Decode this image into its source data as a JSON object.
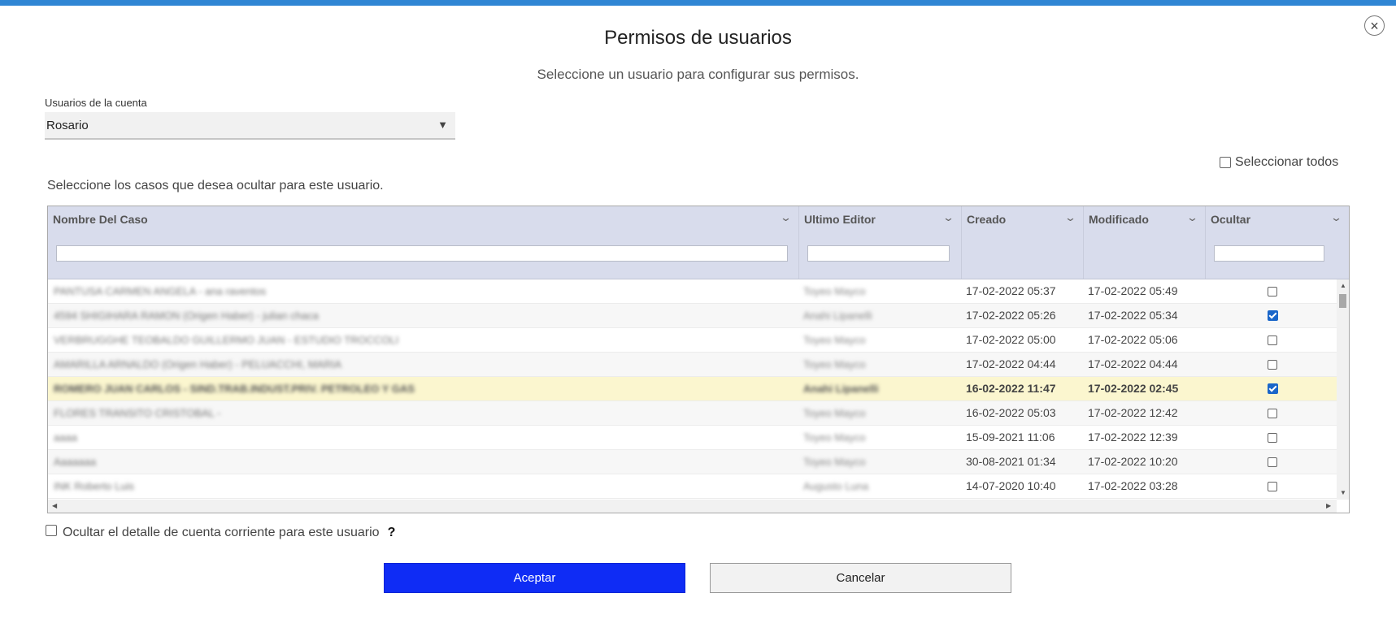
{
  "dialog": {
    "title": "Permisos de usuarios",
    "subtitle": "Seleccione un usuario para configurar sus permisos.",
    "close_symbol": "×"
  },
  "user_select": {
    "label": "Usuarios de la cuenta",
    "value": "Rosario",
    "arrow": "▼"
  },
  "select_all": {
    "label": "Seleccionar todos",
    "checked": false
  },
  "instructions": "Seleccione los casos que desea ocultar para este usuario.",
  "table": {
    "columns": [
      {
        "label": "Nombre Del Caso",
        "icon": "chevron-down-icon"
      },
      {
        "label": "Ultimo Editor",
        "icon": "chevron-down-icon"
      },
      {
        "label": "Creado",
        "icon": "chevron-down-icon"
      },
      {
        "label": "Modificado",
        "icon": "chevron-down-icon"
      },
      {
        "label": "Ocultar",
        "icon": "chevron-down-icon"
      }
    ],
    "rows": [
      {
        "name": "PANTUSA CARMEN ANGELA - ana raventos",
        "editor": "Toyeo Mayco",
        "created": "17-02-2022 05:37",
        "modified": "17-02-2022 05:49",
        "hidden": false,
        "selected": false
      },
      {
        "name": "4594 SHIGIHARA RAMON (Origen Haber) - julian chaca",
        "editor": "Anahi Lipanelli",
        "created": "17-02-2022 05:26",
        "modified": "17-02-2022 05:34",
        "hidden": true,
        "selected": false
      },
      {
        "name": "VERBRUGGHE TEOBALDO GUILLERMO JUAN - ESTUDIO TROCCOLI",
        "editor": "Toyeo Mayco",
        "created": "17-02-2022 05:00",
        "modified": "17-02-2022 05:06",
        "hidden": false,
        "selected": false
      },
      {
        "name": "AMARILLA ARNALDO (Origen Haber) - PELUACCHI, MARIA",
        "editor": "Toyeo Mayco",
        "created": "17-02-2022 04:44",
        "modified": "17-02-2022 04:44",
        "hidden": false,
        "selected": false
      },
      {
        "name": "ROMERO JUAN CARLOS - SIND.TRAB.INDUST.PRIV. PETROLEO Y GAS",
        "editor": "Anahi Lipanelli",
        "created": "16-02-2022 11:47",
        "modified": "17-02-2022 02:45",
        "hidden": true,
        "selected": true
      },
      {
        "name": "FLORES TRANSITO CRISTOBAL -",
        "editor": "Toyeo Mayco",
        "created": "16-02-2022 05:03",
        "modified": "17-02-2022 12:42",
        "hidden": false,
        "selected": false
      },
      {
        "name": "aaaa",
        "editor": "Toyeo Mayco",
        "created": "15-09-2021 11:06",
        "modified": "17-02-2022 12:39",
        "hidden": false,
        "selected": false
      },
      {
        "name": "Aaaaaaa",
        "editor": "Toyeo Mayco",
        "created": "30-08-2021 01:34",
        "modified": "17-02-2022 10:20",
        "hidden": false,
        "selected": false
      },
      {
        "name": "INK Roberto Luis",
        "editor": "Augusto Luna",
        "created": "14-07-2020 10:40",
        "modified": "17-02-2022 03:28",
        "hidden": false,
        "selected": false
      }
    ]
  },
  "hide_account": {
    "label": "Ocultar el detalle de cuenta corriente para este usuario",
    "help": "?",
    "checked": false
  },
  "buttons": {
    "accept": "Aceptar",
    "cancel": "Cancelar"
  },
  "colors": {
    "accent": "#0f2cf5",
    "header_bg": "#d8dcec",
    "selected_row": "#fbf6cf",
    "checkbox_checked": "#1a66c9"
  }
}
